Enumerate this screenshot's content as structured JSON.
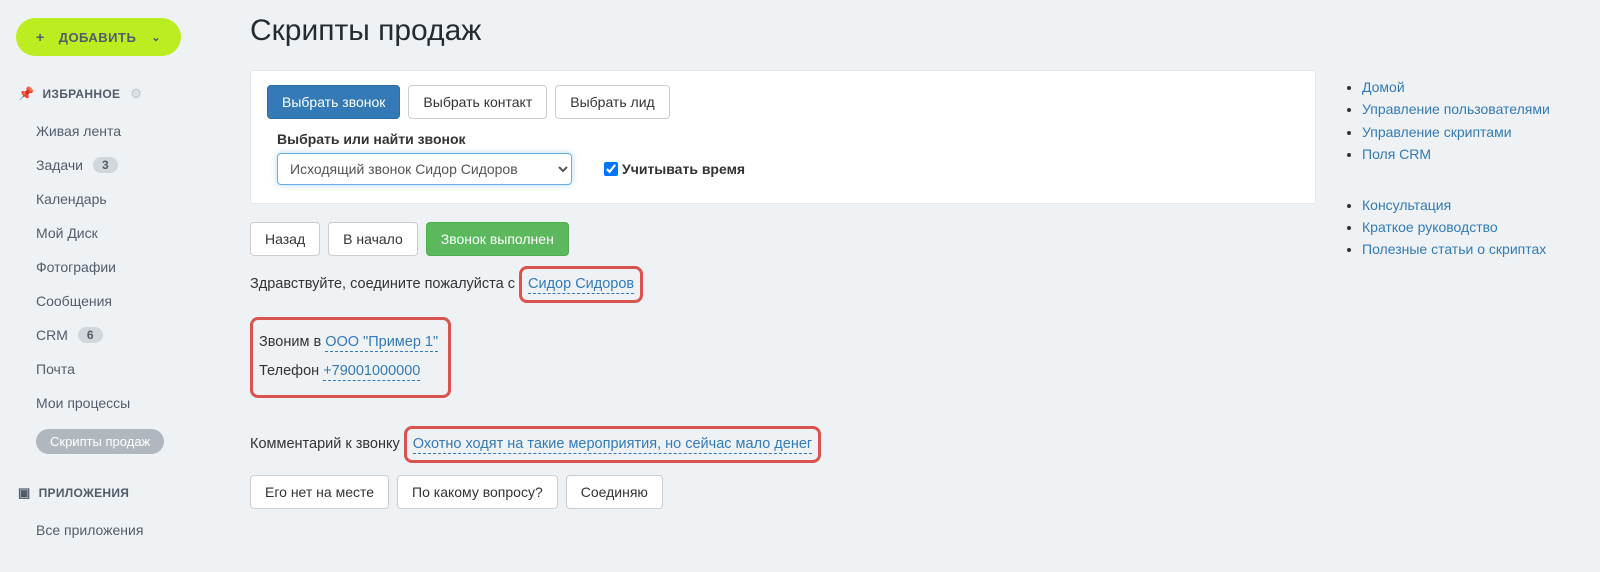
{
  "sidebar": {
    "add_label": "ДОБАВИТЬ",
    "fav_title": "ИЗБРАННОЕ",
    "items": [
      {
        "label": "Живая лента",
        "badge": ""
      },
      {
        "label": "Задачи",
        "badge": "3"
      },
      {
        "label": "Календарь",
        "badge": ""
      },
      {
        "label": "Мой Диск",
        "badge": ""
      },
      {
        "label": "Фотографии",
        "badge": ""
      },
      {
        "label": "Сообщения",
        "badge": ""
      },
      {
        "label": "CRM",
        "badge": "6"
      },
      {
        "label": "Почта",
        "badge": ""
      },
      {
        "label": "Мои процессы",
        "badge": ""
      },
      {
        "label": "Скрипты продаж",
        "badge": ""
      }
    ],
    "apps_title": "ПРИЛОЖЕНИЯ",
    "apps_item": "Все приложения"
  },
  "page": {
    "title": "Скрипты продаж"
  },
  "panel": {
    "tab1": "Выбрать звонок",
    "tab2": "Выбрать контакт",
    "tab3": "Выбрать лид",
    "select_label": "Выбрать или найти звонок",
    "select_value": "Исходящий звонок Сидор Сидоров",
    "checkbox_label": "Учитывать время"
  },
  "script": {
    "btn_back": "Назад",
    "btn_start": "В начало",
    "btn_done": "Звонок выполнен",
    "greet_prefix": "Здравствуйте, соедините пожалуйста с ",
    "contact_name": "Сидор Сидоров",
    "calling_prefix": "Звоним в ",
    "company": "ООО \"Пример 1\"",
    "phone_prefix": "Телефон ",
    "phone": "+79001000000",
    "comment_prefix": "Комментарий к звонку ",
    "comment_value": "Охотно ходят на такие мероприятия, но сейчас мало денег",
    "opt1": "Его нет на месте",
    "opt2": "По какому вопросу?",
    "opt3": "Соединяю"
  },
  "right": {
    "g1": [
      "Домой",
      "Управление пользователями",
      "Управление скриптами",
      "Поля CRM"
    ],
    "g2": [
      "Консультация",
      "Краткое руководство",
      "Полезные статьи о скриптах"
    ]
  }
}
